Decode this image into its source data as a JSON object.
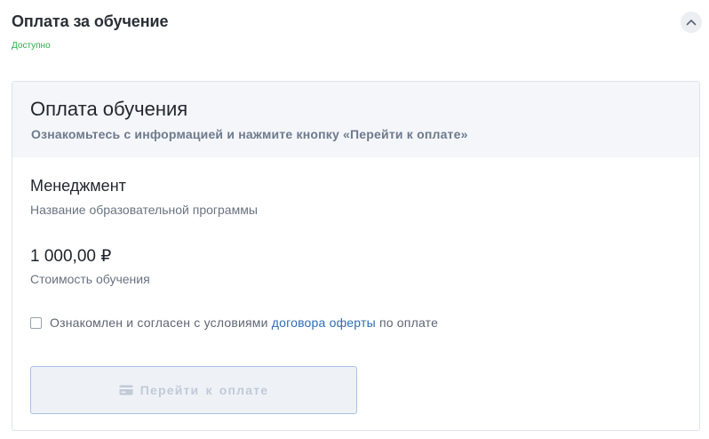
{
  "section": {
    "title": "Оплата за обучение",
    "status": "Доступно",
    "status_color": "#2bb04a",
    "collapse_icon": "chevron-up-icon"
  },
  "card": {
    "title": "Оплата обучения",
    "subtitle": "Ознакомьтесь с информацией и нажмите кнопку «Перейти к оплате»"
  },
  "program": {
    "name": "Менеджмент",
    "label": "Название образовательной программы"
  },
  "price": {
    "value": "1 000,00 ₽",
    "label": "Стоимость обучения"
  },
  "agreement": {
    "checked": false,
    "text_before": "Ознакомлен и согласен с условиями ",
    "link_text": "договора оферты",
    "text_after": " по оплате",
    "link_color": "#2f6db5"
  },
  "pay_button": {
    "label": "Перейти к оплате",
    "icon": "credit-card-icon",
    "disabled": true
  }
}
